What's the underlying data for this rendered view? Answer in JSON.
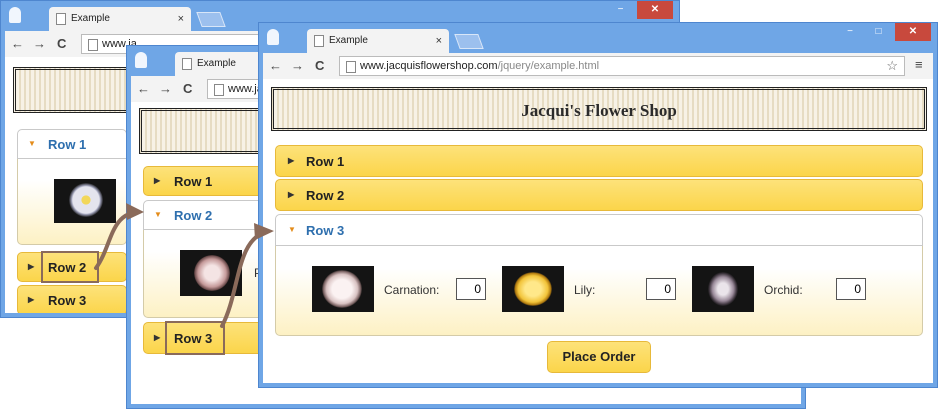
{
  "browser": {
    "tab_title": "Example",
    "tab_close": "×",
    "back": "←",
    "forward": "→",
    "reload": "C",
    "menu": "≡",
    "star": "☆",
    "address_host": "www.jacquisflowershop.com",
    "address_path": "/jquery/example.html",
    "address_host_short_1": "www.ja",
    "address_host_short_2": "www.ja",
    "min": "−",
    "max": "□",
    "close": "✕"
  },
  "page": {
    "shop_title": "Jacqui's Flower Shop",
    "rows": [
      "Row 1",
      "Row 2",
      "Row 3"
    ],
    "flowers": [
      {
        "name": "Carnation:",
        "value": "0"
      },
      {
        "name": "Lily:",
        "value": "0"
      },
      {
        "name": "Orchid:",
        "value": "0"
      }
    ],
    "partial_label": "P",
    "order_button": "Place Order"
  },
  "colors": {
    "frame": "#6fa6e6",
    "header_gold": "#fbd54a",
    "active_row_text": "#2e6fae",
    "arrow_brown": "#8a6a5a"
  }
}
